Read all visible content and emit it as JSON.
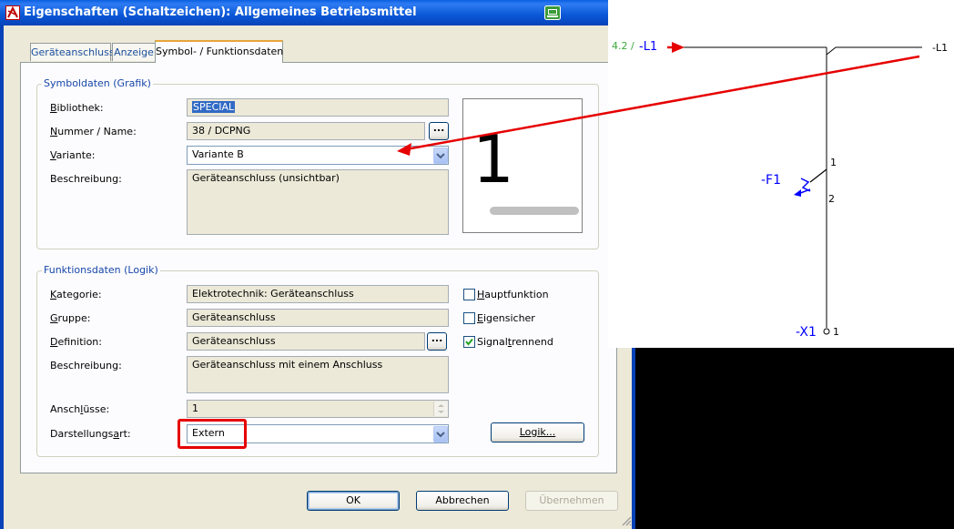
{
  "dialog": {
    "title": "Eigenschaften (Schaltzeichen): Allgemeines Betriebsmittel",
    "tabs": [
      {
        "label": "Geräteanschluss"
      },
      {
        "label": "Anzeige"
      },
      {
        "label": "Symbol- / Funktionsdaten"
      }
    ],
    "symboldaten": {
      "title": "Symboldaten (Grafik)",
      "bibliothek": {
        "label": "Bibliothek:",
        "value": "SPECIAL"
      },
      "nummer": {
        "label": "Nummer / Name:",
        "value": "38 / DCPNG",
        "button": "..."
      },
      "variante": {
        "label": "Variante:",
        "value": "Variante B"
      },
      "beschreibung": {
        "label": "Beschreibung:",
        "value": "Geräteanschluss (unsichtbar)"
      },
      "preview_text": "1"
    },
    "funktionsdaten": {
      "title": "Funktionsdaten (Logik)",
      "kategorie": {
        "label": "Kategorie:",
        "value": "Elektrotechnik: Geräteanschluss"
      },
      "gruppe": {
        "label": "Gruppe:",
        "value": "Geräteanschluss"
      },
      "definition": {
        "label": "Definition:",
        "value": "Geräteanschluss",
        "button": "..."
      },
      "beschreibung": {
        "label": "Beschreibung:",
        "value": "Geräteanschluss mit einem Anschluss"
      },
      "anschluesse": {
        "label": "Anschlüsse:",
        "value": "1"
      },
      "darstellungsart": {
        "label": "Darstellungsart:",
        "value": "Extern"
      },
      "checkboxes": [
        {
          "label": "Hauptfunktion",
          "checked": false
        },
        {
          "label": "Eigensicher",
          "checked": false
        },
        {
          "label": "Signaltrennend",
          "checked": true
        }
      ],
      "logik_button": "Logik..."
    },
    "buttons": {
      "ok": "OK",
      "cancel": "Abbrechen",
      "apply": "Übernehmen"
    }
  },
  "schematic": {
    "ref_left": "4.2 /",
    "net_left": "-L1",
    "net_right": "-L1",
    "device": "-F1",
    "pin_top": "1",
    "pin_bottom": "2",
    "terminal": "-X1",
    "terminal_pin": "1"
  },
  "colors": {
    "annotation_red": "#E60000",
    "xp_blue": "#0A57D6",
    "schematic_blue": "#0000FF",
    "ref_green": "#39A839"
  }
}
